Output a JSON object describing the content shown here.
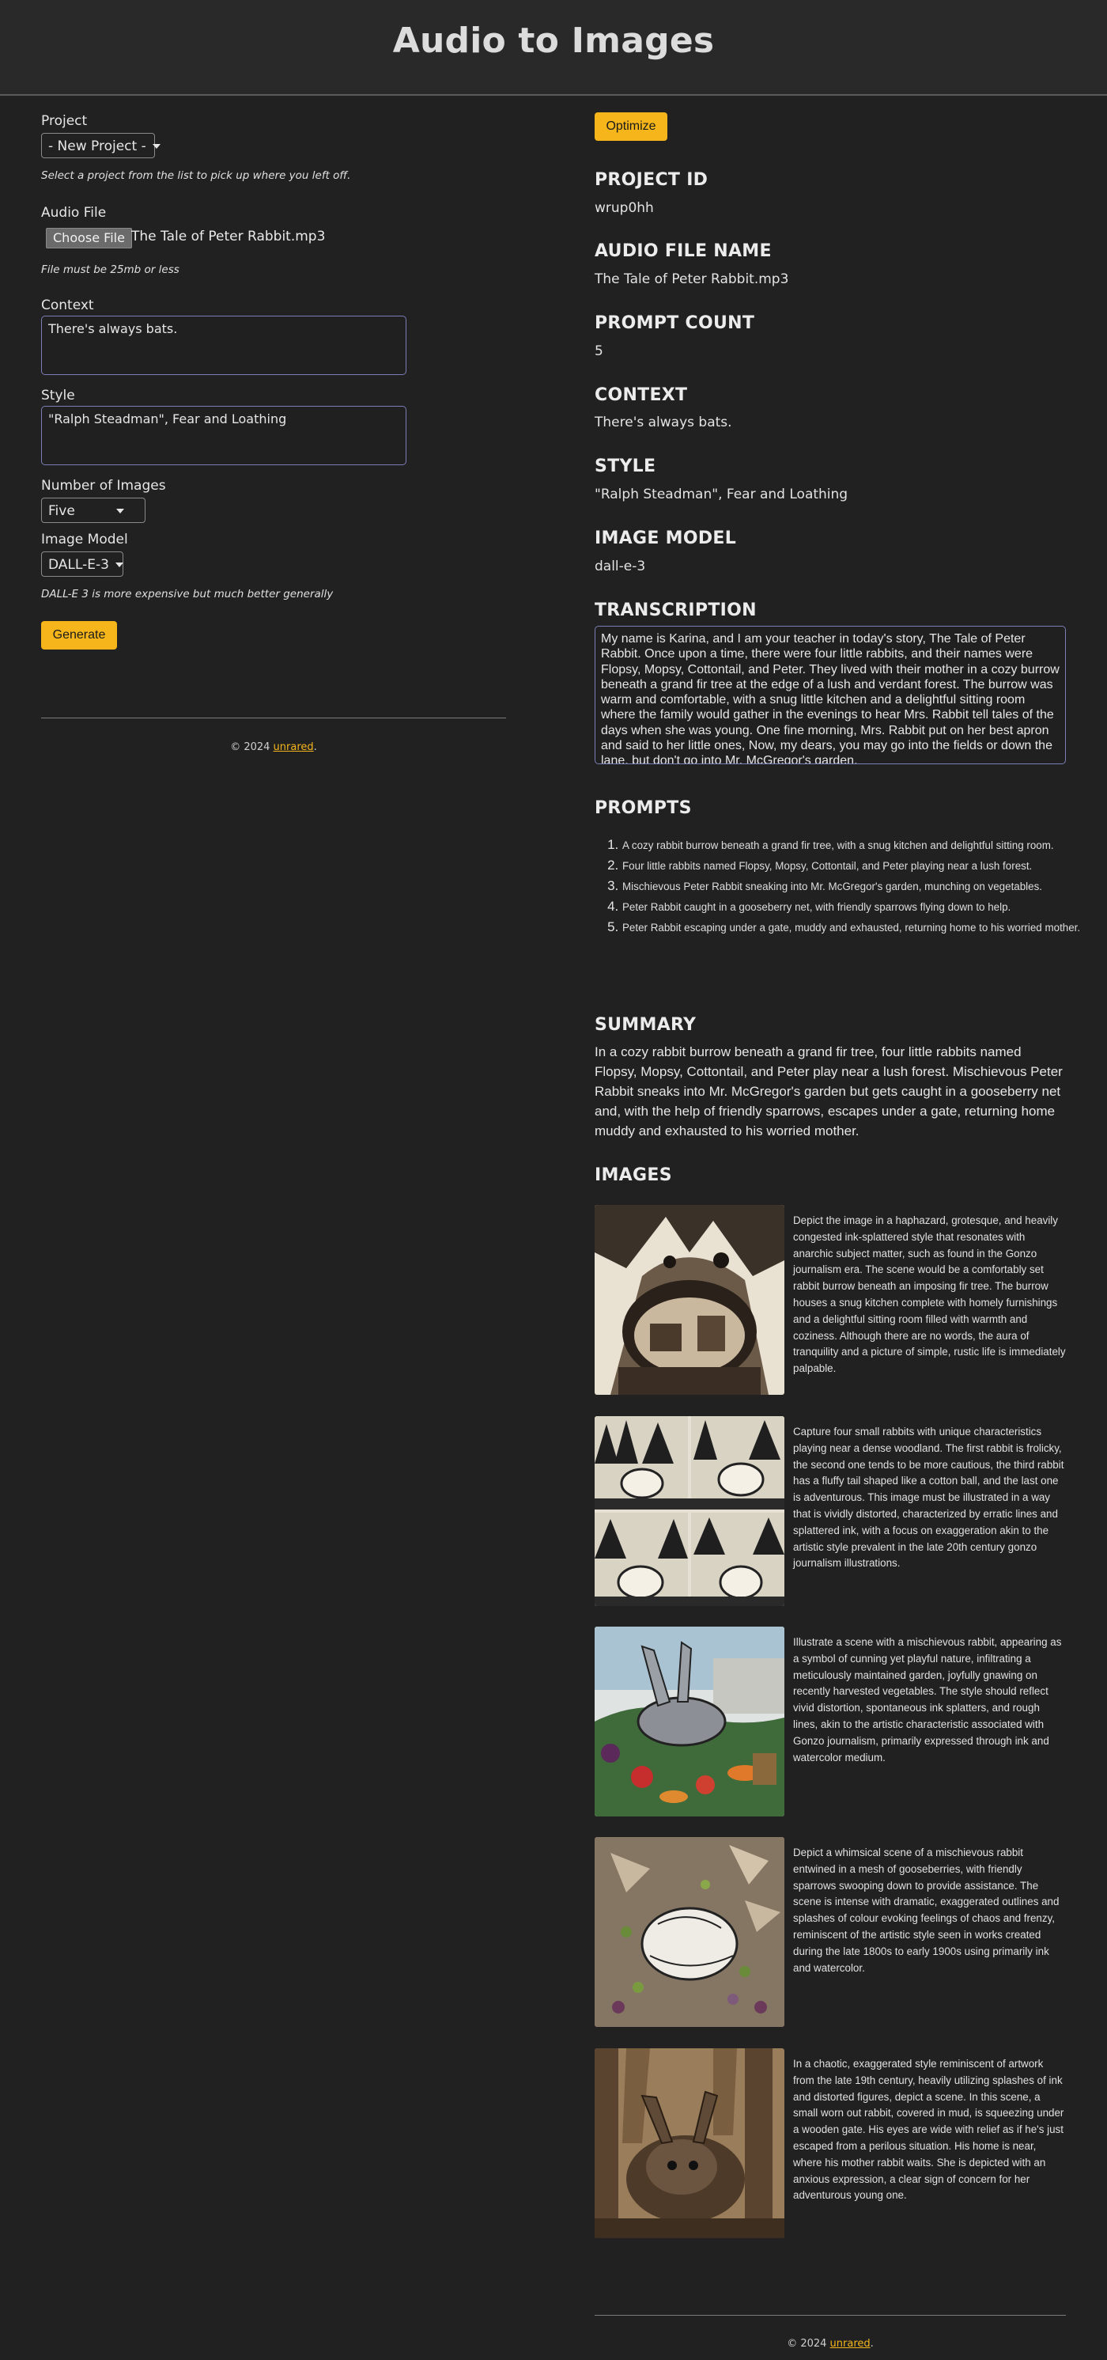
{
  "header": {
    "title": "Audio to Images"
  },
  "form": {
    "project_label": "Project",
    "project_value": "- New Project -",
    "project_hint": "Select a project from the list to pick up where you left off.",
    "audio_label": "Audio File",
    "choose_file_label": "Choose File",
    "file_name": "The Tale of Peter Rabbit.mp3",
    "file_hint": "File must be 25mb or less",
    "context_label": "Context",
    "context_value": "There's always bats.",
    "style_label": "Style",
    "style_value": "\"Ralph Steadman\", Fear and Loathing",
    "num_images_label": "Number of Images",
    "num_images_value": "Five",
    "image_model_label": "Image Model",
    "image_model_value": "DALL-E-3",
    "image_model_hint": "DALL-E 3 is more expensive but much better generally",
    "generate_label": "Generate"
  },
  "footer": {
    "copyright": "© 2024 ",
    "link": "unrared",
    "period": "."
  },
  "result": {
    "optimize_label": "Optimize",
    "project_id_heading": "PROJECT ID",
    "project_id": "wrup0hh",
    "audio_file_heading": "AUDIO FILE NAME",
    "audio_file_name": "The Tale of Peter Rabbit.mp3",
    "prompt_count_heading": "PROMPT COUNT",
    "prompt_count": "5",
    "context_heading": "CONTEXT",
    "context": "There's always bats.",
    "style_heading": "STYLE",
    "style": "\"Ralph Steadman\", Fear and Loathing",
    "image_model_heading": "IMAGE MODEL",
    "image_model": "dall-e-3",
    "transcription_heading": "TRANSCRIPTION",
    "transcription": "My name is Karina, and I am your teacher in today's story, The Tale of Peter Rabbit. Once upon a time, there were four little rabbits, and their names were Flopsy, Mopsy, Cottontail, and Peter. They lived with their mother in a cozy burrow beneath a grand fir tree at the edge of a lush and verdant forest. The burrow was warm and comfortable, with a snug little kitchen and a delightful sitting room where the family would gather in the evenings to hear Mrs. Rabbit tell tales of the days when she was young. One fine morning, Mrs. Rabbit put on her best apron and said to her little ones, Now, my dears, you may go into the fields or down the lane, but don't go into Mr. McGregor's garden.",
    "prompts_heading": "PROMPTS",
    "prompts": [
      "A cozy rabbit burrow beneath a grand fir tree, with a snug kitchen and delightful sitting room.",
      "Four little rabbits named Flopsy, Mopsy, Cottontail, and Peter playing near a lush forest.",
      "Mischievous Peter Rabbit sneaking into Mr. McGregor's garden, munching on vegetables.",
      "Peter Rabbit caught in a gooseberry net, with friendly sparrows flying down to help.",
      "Peter Rabbit escaping under a gate, muddy and exhausted, returning home to his worried mother."
    ],
    "summary_heading": "SUMMARY",
    "summary": "In a cozy rabbit burrow beneath a grand fir tree, four little rabbits named Flopsy, Mopsy, Cottontail, and Peter play near a lush forest. Mischievous Peter Rabbit sneaks into Mr. McGregor's garden but gets caught in a gooseberry net and, with the help of friendly sparrows, escapes under a gate, returning home muddy and exhausted to his worried mother.",
    "images_heading": "IMAGES",
    "images": [
      {
        "icon": "burrow-illustration",
        "description": "Depict the image in a haphazard, grotesque, and heavily congested ink-splattered style that resonates with anarchic subject matter, such as found in the Gonzo journalism era. The scene would be a comfortably set rabbit burrow beneath an imposing fir tree. The burrow houses a snug kitchen complete with homely furnishings and a delightful sitting room filled with warmth and coziness. Although there are no words, the aura of tranquility and a picture of simple, rustic life is immediately palpable."
      },
      {
        "icon": "four-rabbits-illustration",
        "description": "Capture four small rabbits with unique characteristics playing near a dense woodland. The first rabbit is frolicky, the second one tends to be more cautious, the third rabbit has a fluffy tail shaped like a cotton ball, and the last one is adventurous. This image must be illustrated in a way that is vividly distorted, characterized by erratic lines and splattered ink, with a focus on exaggeration akin to the artistic style prevalent in the late 20th century gonzo journalism illustrations."
      },
      {
        "icon": "garden-rabbit-illustration",
        "description": "Illustrate a scene with a mischievous rabbit, appearing as a symbol of cunning yet playful nature, infiltrating a meticulously maintained garden, joyfully gnawing on recently harvested vegetables. The style should reflect vivid distortion, spontaneous ink splatters, and rough lines, akin to the artistic characteristic associated with Gonzo journalism, primarily expressed through ink and watercolor medium."
      },
      {
        "icon": "gooseberry-net-illustration",
        "description": "Depict a whimsical scene of a mischievous rabbit entwined in a mesh of gooseberries, with friendly sparrows swooping down to provide assistance. The scene is intense with dramatic, exaggerated outlines and splashes of colour evoking feelings of chaos and frenzy, reminiscent of the artistic style seen in works created during the late 1800s to early 1900s using primarily ink and watercolor."
      },
      {
        "icon": "muddy-rabbit-illustration",
        "description": "In a chaotic, exaggerated style reminiscent of artwork from the late 19th century, heavily utilizing splashes of ink and distorted figures, depict a scene. In this scene, a small worn out rabbit, covered in mud, is squeezing under a wooden gate. His eyes are wide with relief as if he's just escaped from a perilous situation. His home is near, where his mother rabbit waits. She is depicted with an anxious expression, a clear sign of concern for her adventurous young one."
      }
    ]
  },
  "colors": {
    "accent": "#f5b51b",
    "background": "#212121",
    "header": "#292929",
    "input_border": "#7a7fb5"
  }
}
